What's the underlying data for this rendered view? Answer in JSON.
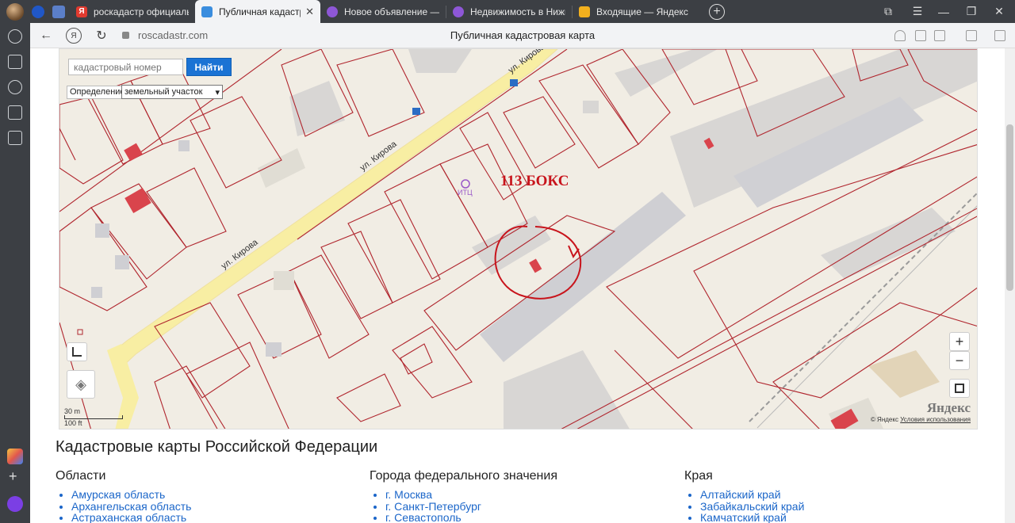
{
  "tabs": [
    {
      "label": "роскадастр официальный",
      "icon": "yandex-icon",
      "color": "#e03a2f"
    },
    {
      "label": "Публичная кадастровая карта",
      "icon": "map-favicon",
      "color": "#3a8dde",
      "active": true
    },
    {
      "label": "Новое объявление — Об",
      "icon": "avito-icon",
      "color": "#8e57d7"
    },
    {
      "label": "Недвижимость в Нижнем",
      "icon": "avito-icon",
      "color": "#8e57d7"
    },
    {
      "label": "Входящие — Яндекс Почта",
      "icon": "mail-icon",
      "color": "#f2b01e"
    }
  ],
  "address": {
    "url": "roscadastr.com",
    "title": "Публичная кадастровая карта"
  },
  "map": {
    "search_placeholder": "кадастровый номер",
    "search_button": "Найти",
    "definition_label": "Определение:",
    "definition_value": "земельный участок",
    "annotation": "113 БОКС",
    "scale_m": "30 m",
    "scale_ft": "100 ft",
    "brand": "Яндекс",
    "copyright": "© Яндекс",
    "terms": "Условия использования",
    "zoom_in": "+",
    "zoom_out": "−",
    "streets": [
      "ул. Кирова",
      "ул. Кирова",
      "ул. Кирова"
    ],
    "poi_label": "ИТЦ"
  },
  "content": {
    "title": "Кадастровые карты Российской Федерации",
    "columns": [
      {
        "heading": "Области",
        "items": [
          "Амурская область",
          "Архангельская область",
          "Астраханская область"
        ]
      },
      {
        "heading": "Города федерального значения",
        "items": [
          "г. Москва",
          "г. Санкт-Петербург",
          "г. Севастополь"
        ]
      },
      {
        "heading": "Края",
        "items": [
          "Алтайский край",
          "Забайкальский край",
          "Камчатский край"
        ]
      }
    ]
  }
}
